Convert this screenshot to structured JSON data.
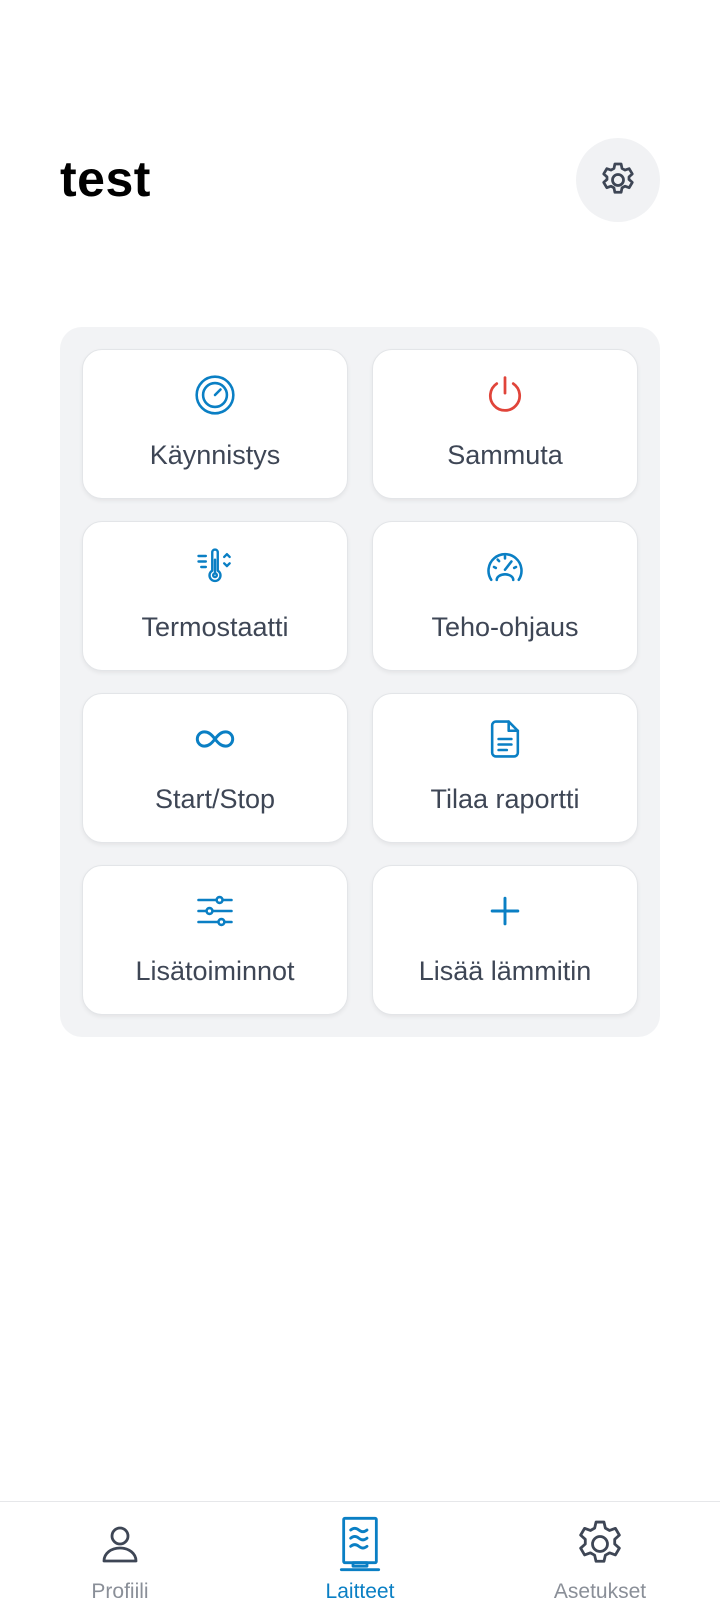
{
  "header": {
    "title": "test",
    "settings_icon": "gear-icon"
  },
  "colors": {
    "accent": "#0a7fc4",
    "danger": "#e0443a",
    "text": "#3e4655",
    "muted": "#8a8f98",
    "panel": "#f2f3f5"
  },
  "tiles": [
    {
      "label": "Käynnistys",
      "icon": "gauge-circle-icon"
    },
    {
      "label": "Sammuta",
      "icon": "power-icon"
    },
    {
      "label": "Termostaatti",
      "icon": "thermometer-icon"
    },
    {
      "label": "Teho-ohjaus",
      "icon": "speedometer-icon"
    },
    {
      "label": "Start/Stop",
      "icon": "infinity-icon"
    },
    {
      "label": "Tilaa raportti",
      "icon": "document-icon"
    },
    {
      "label": "Lisätoiminnot",
      "icon": "sliders-icon"
    },
    {
      "label": "Lisää lämmitin",
      "icon": "plus-icon"
    }
  ],
  "nav": {
    "active": "Laitteet",
    "items": [
      {
        "label": "Profiili",
        "icon": "user-icon"
      },
      {
        "label": "Laitteet",
        "icon": "heater-icon"
      },
      {
        "label": "Asetukset",
        "icon": "gear-icon"
      }
    ]
  }
}
